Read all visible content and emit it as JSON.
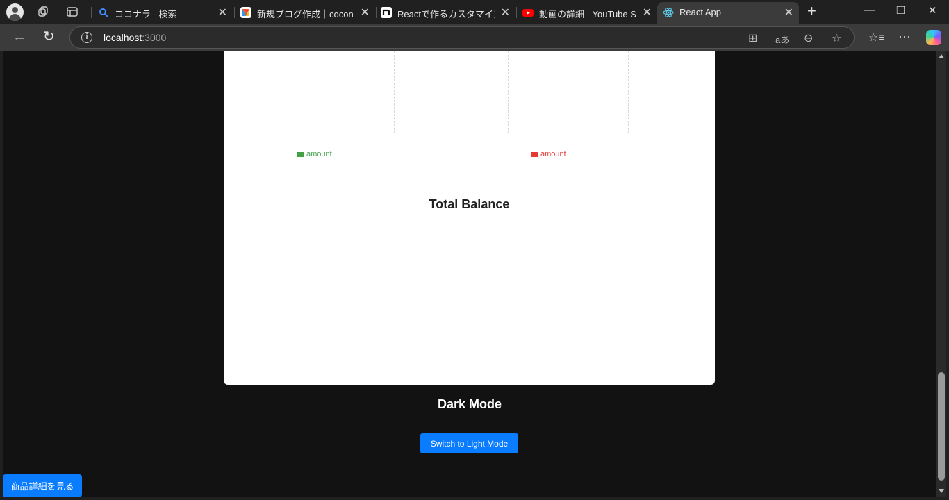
{
  "browser": {
    "tabs": [
      {
        "label": "ココナラ - 検索",
        "favicon": "search-favicon",
        "color": "#1a73e8"
      },
      {
        "label": "新規ブログ作成｜coconalaブ",
        "favicon": "coconala-favicon",
        "color": "#f5a623"
      },
      {
        "label": "Reactで作るカスタマイズ可能な",
        "favicon": "note-favicon",
        "color": "#ffffff"
      },
      {
        "label": "動画の詳細 - YouTube Studio",
        "favicon": "youtube-favicon",
        "color": "#ff0000"
      },
      {
        "label": "React App",
        "favicon": "react-favicon",
        "color": "#61dafb",
        "active": true
      }
    ],
    "url_host": "localhost",
    "url_port": ":3000"
  },
  "page": {
    "charts": [
      {
        "legend": "amount",
        "color": "#43a047"
      },
      {
        "legend": "amount",
        "color": "#e53935"
      }
    ],
    "total_balance_title": "Total Balance",
    "mode_title": "Dark Mode",
    "switch_button_label": "Switch to Light Mode",
    "detail_button_label": "商品詳細を見る",
    "accent_color": "#0a7cff"
  }
}
